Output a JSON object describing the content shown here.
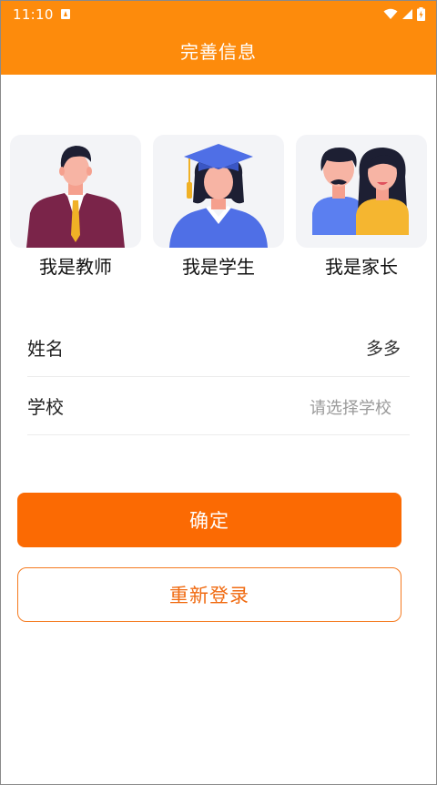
{
  "status_bar": {
    "time": "11:10",
    "icons": [
      "a-notification-icon",
      "wifi-icon",
      "signal-icon",
      "battery-icon"
    ]
  },
  "header": {
    "title": "完善信息"
  },
  "roles": [
    {
      "label": "我是教师",
      "icon": "teacher-illustration"
    },
    {
      "label": "我是学生",
      "icon": "student-illustration"
    },
    {
      "label": "我是家长",
      "icon": "parent-illustration"
    }
  ],
  "form": {
    "name_label": "姓名",
    "name_value": "多多",
    "school_label": "学校",
    "school_placeholder": "请选择学校"
  },
  "buttons": {
    "confirm": "确定",
    "relogin": "重新登录"
  },
  "colors": {
    "primary": "#fd8b0c",
    "confirm_button": "#fb6a03",
    "card_background": "#f3f4f7"
  }
}
